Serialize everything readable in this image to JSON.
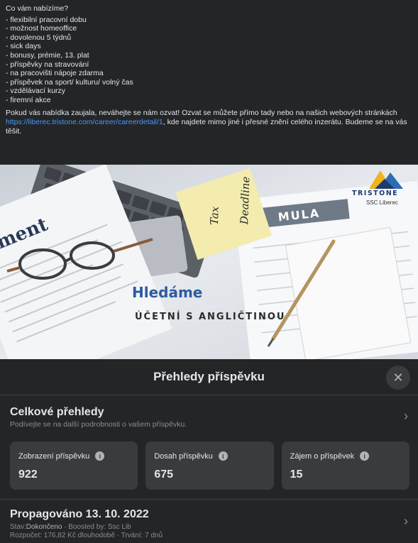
{
  "post": {
    "heading": "Co vám nabízíme?",
    "benefits": [
      "- flexibilní pracovní dobu",
      "- možnost homeoffice",
      "- dovolenou 5 týdnů",
      "- sick days",
      "- bonusy, prémie, 13. plat",
      "- příspěvky na stravování",
      "- na pracovišti nápoje zdarma",
      "- příspěvek na sport/ kulturu/ volný čas",
      "- vzdělávací kurzy",
      "- firemní akce"
    ],
    "para_before_link": "Pokud vás nabídka zaujala, neváhejte se nám ozvat! Ozvat se můžete přímo tady nebo na našich webových stránkách ",
    "link_text": "https://liberec.tristone.com/career/careerdetail/1",
    "para_after_link": ", kde najdete mimo jiné i přesné znění celého inzerátu. Budeme se na vás těšit."
  },
  "image": {
    "headline": "Hledáme",
    "subheadline": "ÚČETNÍ S ANGLIČTINOU",
    "logo_name": "TRISTONE",
    "logo_sub": "SSC Liberec",
    "note_line1": "Tax",
    "note_line2": "Deadline",
    "paper_word": "ement",
    "formula_word": "MULA"
  },
  "sheet": {
    "title": "Přehledy příspěvku",
    "close_symbol": "✕",
    "overall": {
      "title": "Celkové přehledy",
      "subtitle": "Podívejte se na další podrobnosti o vašem příspěvku."
    },
    "metrics": [
      {
        "label": "Zobrazení příspěvku",
        "value": "922"
      },
      {
        "label": "Dosah příspěvku",
        "value": "675"
      },
      {
        "label": "Zájem o příspěvek",
        "value": "15"
      }
    ],
    "promo": {
      "title": "Propagováno 13. 10. 2022",
      "status_label": "Stav:",
      "status_value": "Dokončeno",
      "boosted": "Boosted by: Ssc Lib",
      "budget": "Rozpočet: 176,82 Kč dlouhodobě",
      "duration": "Trvání: 7 dnů"
    },
    "chevron": "›",
    "info_symbol": "i"
  }
}
